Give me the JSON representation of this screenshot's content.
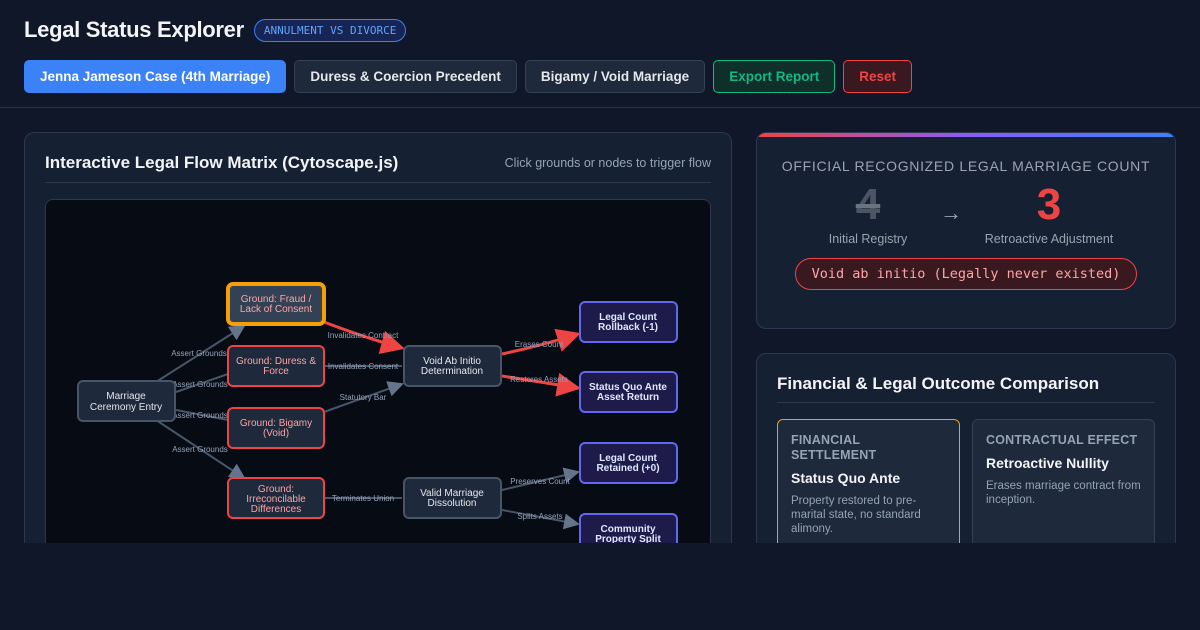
{
  "header": {
    "title": "Legal Status Explorer",
    "badge": "ANNULMENT VS DIVORCE",
    "buttons": {
      "case1": "Jenna Jameson Case (4th Marriage)",
      "case2": "Duress & Coercion Precedent",
      "case3": "Bigamy / Void Marriage",
      "export": "Export Report",
      "reset": "Reset"
    }
  },
  "flow": {
    "title": "Interactive Legal Flow Matrix (Cytoscape.js)",
    "hint": "Click grounds or nodes to trigger flow",
    "nodes": {
      "ceremony": [
        "Marriage",
        "Ceremony Entry"
      ],
      "fraud": [
        "Ground: Fraud /",
        "Lack of Consent"
      ],
      "duress": [
        "Ground: Duress &",
        "Force"
      ],
      "bigamy": [
        "Ground: Bigamy",
        "(Void)"
      ],
      "irreconcilable": [
        "Ground:",
        "Irreconcilable",
        "Differences"
      ],
      "void": [
        "Void Ab Initio",
        "Determination"
      ],
      "valid": [
        "Valid Marriage",
        "Dissolution"
      ],
      "rollback": [
        "Legal Count",
        "Rollback (-1)"
      ],
      "statusquo": [
        "Status Quo Ante",
        "Asset Return"
      ],
      "retained": [
        "Legal Count",
        "Retained (+0)"
      ],
      "community": [
        "Community",
        "Property Split"
      ]
    },
    "edges": {
      "assert": "Assert Grounds",
      "invalidates_contract": "Invalidates Contract",
      "invalidates_consent": "Invalidates Consent",
      "statutory_bar": "Statutory Bar",
      "terminates": "Terminates Union",
      "erases": "Erases Count",
      "restores": "Restores Assets",
      "preserves": "Preserves Count",
      "splits": "Splits Assets"
    }
  },
  "count": {
    "title": "OFFICIAL RECOGNIZED LEGAL MARRIAGE COUNT",
    "initial_value": "4",
    "initial_label": "Initial Registry",
    "arrow": "→",
    "final_value": "3",
    "final_label": "Retroactive Adjustment",
    "status": "Void ab initio (Legally never existed)"
  },
  "outcome": {
    "title": "Financial & Legal Outcome Comparison",
    "cards": [
      {
        "kicker": "FINANCIAL SETTLEMENT",
        "value": "Status Quo Ante",
        "desc": "Property restored to pre-marital state, no standard alimony."
      },
      {
        "kicker": "CONTRACTUAL EFFECT",
        "value": "Retroactive Nullity",
        "desc": "Erases marriage contract from inception."
      }
    ]
  },
  "colors": {
    "accent": "#3b82f6",
    "danger": "#ef4444",
    "success": "#10b981",
    "highlight": "#f59e0b",
    "outcome": "#6366f1"
  }
}
